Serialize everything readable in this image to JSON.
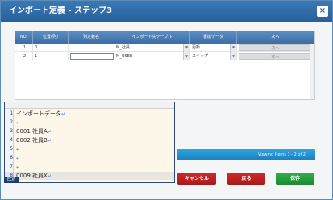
{
  "window": {
    "title": "インポート定義 - ステップ3",
    "close_icon": "×"
  },
  "grid": {
    "headers": [
      "NO.",
      "位置(列)",
      "列定義名",
      "インポート先テーブル",
      "書換データ",
      "次へ"
    ],
    "rows": [
      {
        "no": "1",
        "pos": "0",
        "colname": "",
        "table": "M_社員",
        "mode": "更新",
        "next": "次へ"
      },
      {
        "no": "2",
        "pos": "1",
        "colname": "",
        "table": "M_USER",
        "mode": "スキップ",
        "next": "次へ"
      }
    ]
  },
  "editor": {
    "lines": [
      {
        "num": "1",
        "text": "インポートデータ"
      },
      {
        "num": "2",
        "text": ""
      },
      {
        "num": "3",
        "text": "0001 社員A"
      },
      {
        "num": "4",
        "text": "0002 社員B"
      },
      {
        "num": "5",
        "text": ""
      },
      {
        "num": "6",
        "text": ""
      },
      {
        "num": "7",
        "text": ""
      },
      {
        "num": "8",
        "text": "0009 社員X"
      }
    ],
    "line_marker": "↵",
    "mode_badge": "EOF"
  },
  "status": {
    "text": "Viewing Items 1 - 2 of 2"
  },
  "buttons": {
    "cancel": "キャンセル",
    "back": "戻る",
    "ok": "保存"
  }
}
